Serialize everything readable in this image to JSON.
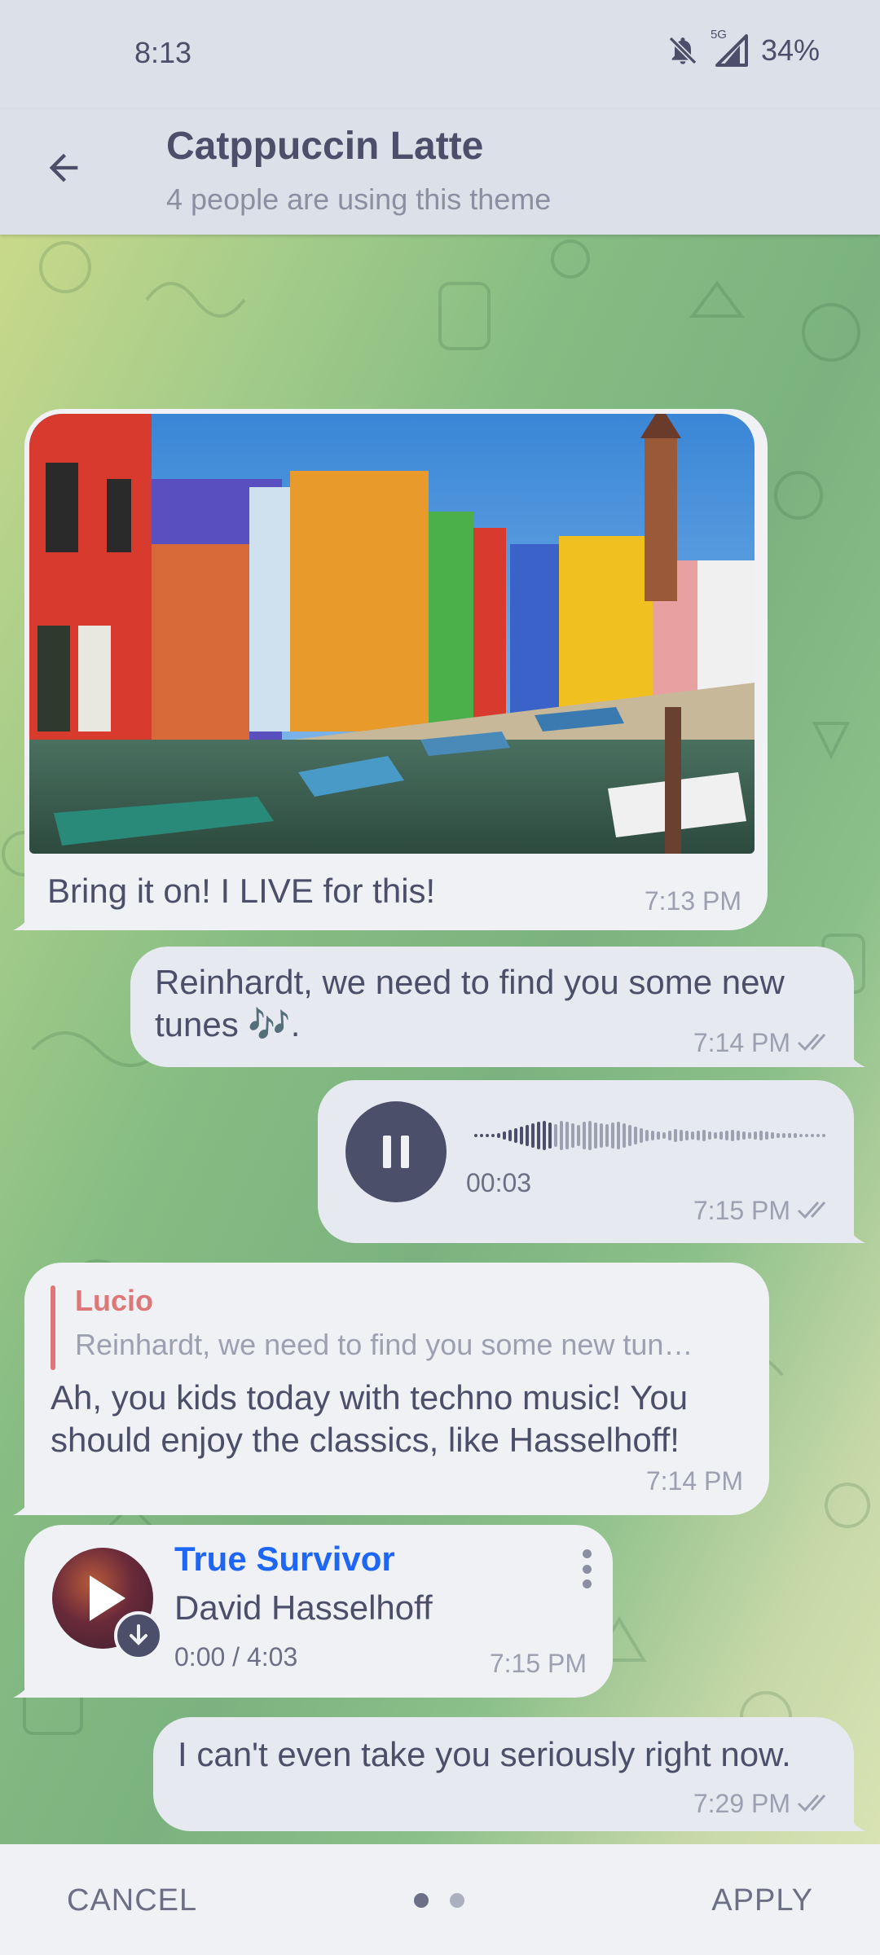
{
  "status_bar": {
    "time": "8:13",
    "network": "5G",
    "battery": "34%"
  },
  "header": {
    "title": "Catppuccin Latte",
    "subtitle": "4 people are using this theme"
  },
  "messages": {
    "photo_caption": {
      "text": "Bring it on! I LIVE for this!",
      "time": "7:13 PM"
    },
    "out_text1": {
      "line1": "Reinhardt, we need to find you some new",
      "line2": "tunes 🎶.",
      "time": "7:14 PM"
    },
    "voice": {
      "duration": "00:03",
      "time": "7:15 PM"
    },
    "reply": {
      "quote_name": "Lucio",
      "quote_text": "Reinhardt, we need to find you some new tun…",
      "line1": "Ah, you kids today with techno music! You",
      "line2": "should enjoy the classics, like Hasselhoff!",
      "time": "7:14 PM"
    },
    "audio": {
      "title": "True Survivor",
      "artist": "David Hasselhoff",
      "progress": "0:00 / 4:03",
      "time": "7:15 PM"
    },
    "out_text2": {
      "text": "I can't even take you seriously right now.",
      "time": "7:29 PM"
    }
  },
  "footer": {
    "cancel_label": "CANCEL",
    "apply_label": "APPLY",
    "page_indicator": {
      "current": 1,
      "total": 2
    }
  },
  "colors": {
    "accent_blue": "#1e66f5",
    "quote_red": "#dd7878",
    "text": "#4c4f69",
    "subtext": "#9ca0b0"
  }
}
